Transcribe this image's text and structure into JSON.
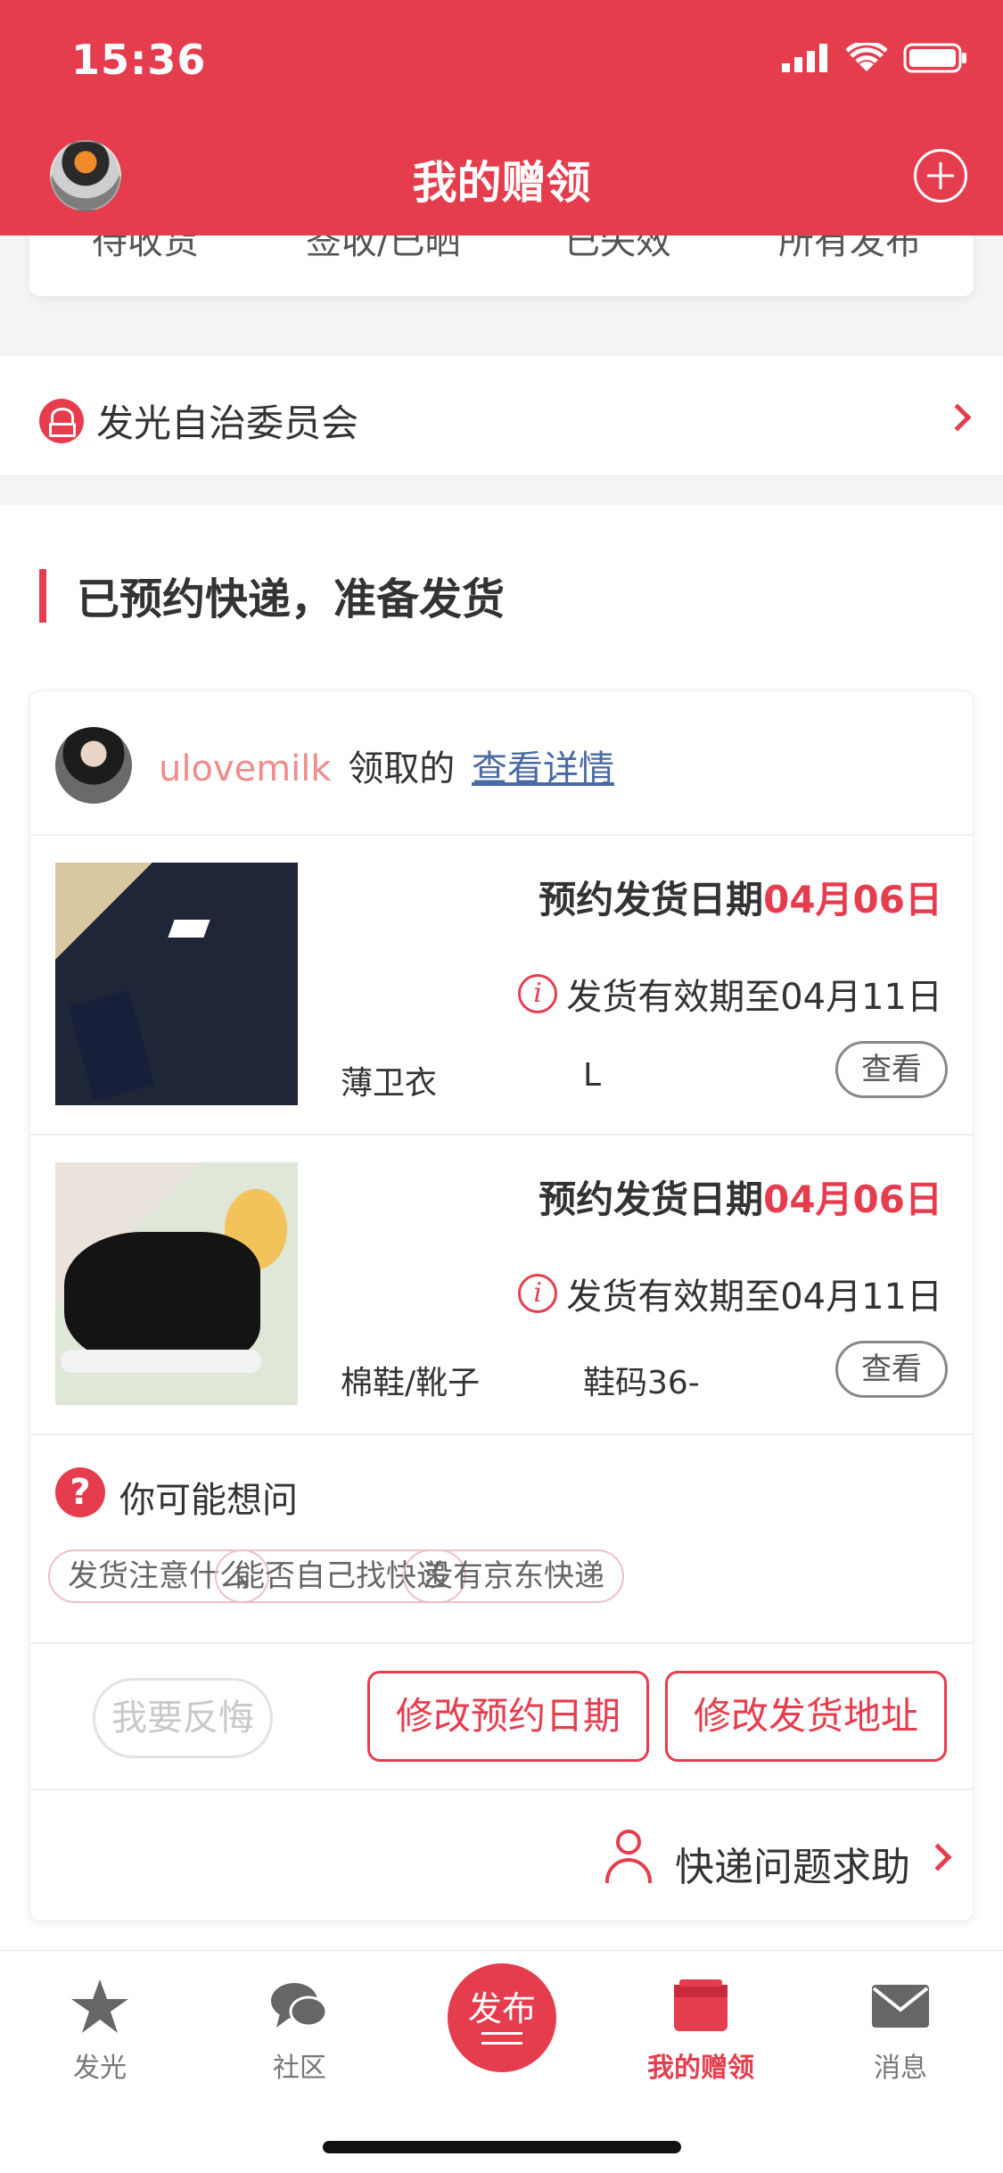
{
  "status_bar": {
    "time": "15:36"
  },
  "header": {
    "title": "我的赠领"
  },
  "tabs": [
    "待收货",
    "签收/已晒",
    "已失效",
    "所有发布"
  ],
  "org": {
    "name": "发光自治委员会"
  },
  "section": {
    "title": "已预约快递，准备发货"
  },
  "card": {
    "user": "ulovemilk",
    "mid_text": "领取的",
    "link": "查看详情",
    "items": [
      {
        "date_label": "预约发货日期",
        "date_value": "04月06日",
        "validity": "发货有效期至04月11日",
        "name": "薄卫衣",
        "size": "L",
        "view_label": "查看",
        "image": "navy-sweatshirt-photo"
      },
      {
        "date_label": "预约发货日期",
        "date_value": "04月06日",
        "validity": "发货有效期至04月11日",
        "name": "棉鞋/靴子",
        "size": "鞋码36-",
        "view_label": "查看",
        "image": "black-sneakers-photo"
      }
    ],
    "faq": {
      "title": "你可能想问",
      "chips": [
        "发货注意什么",
        "能否自己找快递",
        "没有京东快递"
      ]
    },
    "actions": {
      "regret": "我要反悔",
      "modify_date": "修改预约日期",
      "modify_address": "修改发货地址"
    },
    "help": {
      "label": "快递问题求助"
    }
  },
  "tabbar": {
    "items": [
      {
        "label": "发光",
        "icon": "star-icon"
      },
      {
        "label": "社区",
        "icon": "chat-bubbles-icon"
      },
      {
        "label": "发布",
        "icon": "publish-icon"
      },
      {
        "label": "我的赠领",
        "icon": "gift-box-icon",
        "active": true
      },
      {
        "label": "消息",
        "icon": "mail-icon"
      }
    ]
  },
  "colors": {
    "accent": "#e63d4e",
    "link": "#4a6aa5",
    "username": "#ef8c8c"
  }
}
